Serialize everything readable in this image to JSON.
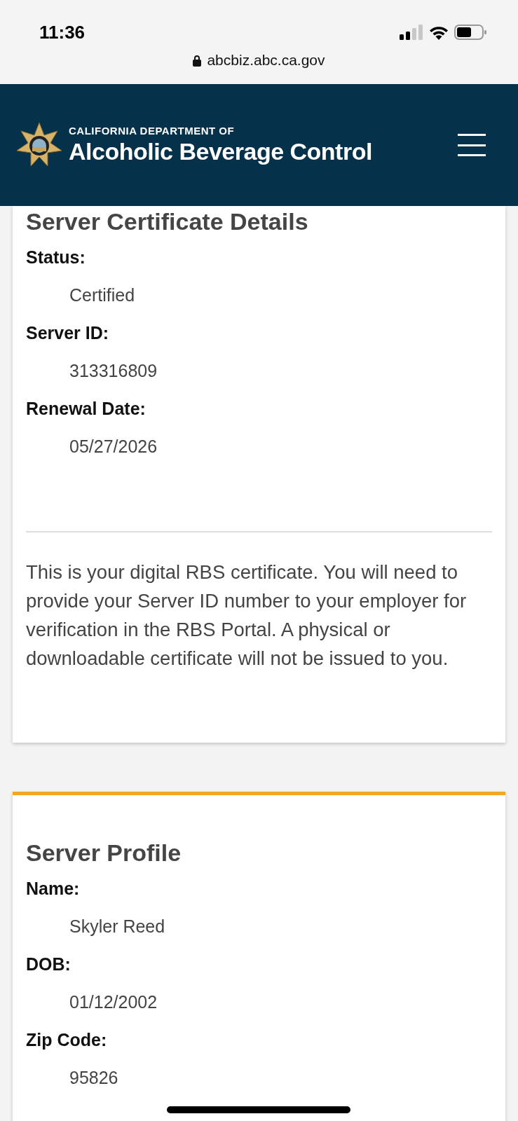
{
  "status_bar": {
    "time": "11:36"
  },
  "browser": {
    "url": "abcbiz.abc.ca.gov"
  },
  "header": {
    "subtitle": "CALIFORNIA DEPARTMENT OF",
    "title": "Alcoholic Beverage Control"
  },
  "cards": [
    {
      "title": "Server Certificate Details",
      "accent": false,
      "fields": [
        {
          "label": "Status:",
          "value": "Certified"
        },
        {
          "label": "Server ID:",
          "value": "313316809"
        },
        {
          "label": "Renewal Date:",
          "value": "05/27/2026"
        }
      ],
      "note": "This is your digital RBS certificate. You will need to provide your Server ID number to your employer for verification in the RBS Portal. A physical or downloadable certificate will not be issued to you."
    },
    {
      "title": "Server Profile",
      "accent": true,
      "fields": [
        {
          "label": "Name:",
          "value": "Skyler Reed"
        },
        {
          "label": "DOB:",
          "value": "01/12/2002"
        },
        {
          "label": "Zip Code:",
          "value": "95826"
        }
      ]
    }
  ]
}
